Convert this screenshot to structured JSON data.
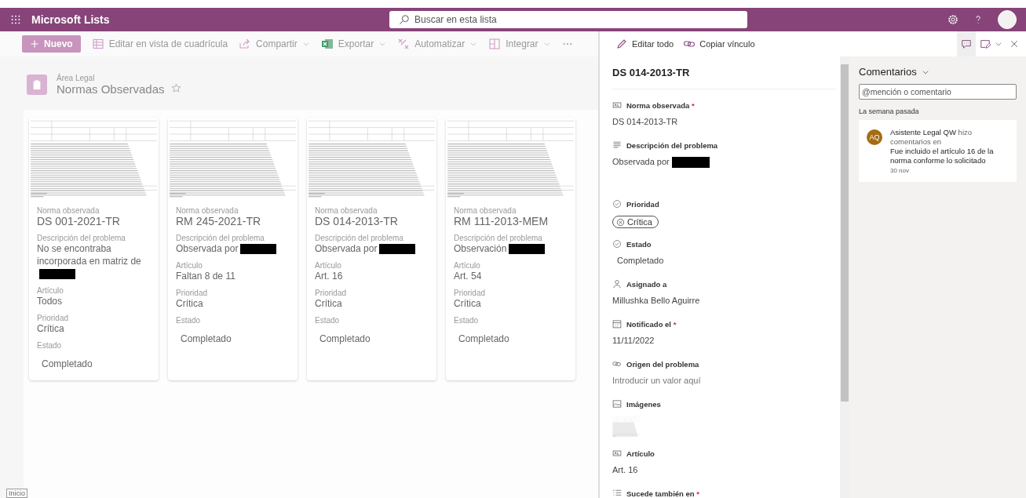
{
  "app": {
    "name": "Microsoft Lists"
  },
  "search": {
    "placeholder": "Buscar en esta lista"
  },
  "toolbar": {
    "new_button": "Nuevo",
    "actions": [
      {
        "kind": "grid",
        "label": "Editar en vista de cuadrícula",
        "dropdown": false
      },
      {
        "kind": "share",
        "label": "Compartir",
        "dropdown": true
      },
      {
        "kind": "excel",
        "label": "Exportar",
        "dropdown": true
      },
      {
        "kind": "flow",
        "label": "Automatizar",
        "dropdown": true
      },
      {
        "kind": "integrate",
        "label": "Integrar",
        "dropdown": true
      }
    ]
  },
  "list": {
    "site": "Área Legal",
    "title": "Normas Observadas",
    "favorite": false
  },
  "cards": [
    {
      "fields": [
        {
          "label": "Norma observada",
          "value": "DS 001-2021-TR",
          "redacted": false
        },
        {
          "label": "Descripción del problema",
          "value": "No se encontraba incorporada en matriz de",
          "redacted": true
        },
        {
          "label": "Artículo",
          "value": "Todos",
          "redacted": false
        },
        {
          "label": "Prioridad",
          "value": "Crítica",
          "redacted": false
        },
        {
          "label": "Estado",
          "value": "Completado",
          "redacted": false
        }
      ]
    },
    {
      "fields": [
        {
          "label": "Norma observada",
          "value": "RM 245-2021-TR",
          "redacted": false
        },
        {
          "label": "Descripción del problema",
          "value": "Observada por",
          "redacted": true
        },
        {
          "label": "Artículo",
          "value": "Faltan 8 de 11",
          "redacted": false
        },
        {
          "label": "Prioridad",
          "value": "Crítica",
          "redacted": false
        },
        {
          "label": "Estado",
          "value": "Completado",
          "redacted": false
        }
      ]
    },
    {
      "fields": [
        {
          "label": "Norma observada",
          "value": "DS 014-2013-TR",
          "redacted": false
        },
        {
          "label": "Descripción del problema",
          "value": "Observada por",
          "redacted": true
        },
        {
          "label": "Artículo",
          "value": "Art. 16",
          "redacted": false
        },
        {
          "label": "Prioridad",
          "value": "Crítica",
          "redacted": false
        },
        {
          "label": "Estado",
          "value": "Completado",
          "redacted": false
        }
      ]
    },
    {
      "fields": [
        {
          "label": "Norma observada",
          "value": "RM 111-2013-MEM",
          "redacted": false
        },
        {
          "label": "Descripción del problema",
          "value": "Observación",
          "redacted": true
        },
        {
          "label": "Artículo",
          "value": "Art. 54",
          "redacted": false
        },
        {
          "label": "Prioridad",
          "value": "Crítica",
          "redacted": false
        },
        {
          "label": "Estado",
          "value": "Completado",
          "redacted": false
        }
      ]
    }
  ],
  "panel": {
    "actions": [
      {
        "kind": "edit",
        "label": "Editar todo"
      },
      {
        "kind": "link",
        "label": "Copiar vínculo"
      }
    ],
    "view_buttons": [
      {
        "kind": "comments",
        "selected": true
      },
      {
        "kind": "form",
        "selected": false
      }
    ],
    "title": "DS 014-2013-TR",
    "fields": [
      {
        "label": "Norma observada",
        "required_mark": "*",
        "kind": "text",
        "value": "DS 014-2013-TR",
        "redacted": false
      },
      {
        "label": "Descripción del problema",
        "kind": "text",
        "value": "Observada por",
        "redacted": true
      },
      {
        "label": "Prioridad",
        "kind": "pill",
        "value": "Crítica",
        "redacted": false
      },
      {
        "label": "Estado",
        "kind": "choice",
        "value": "Completado",
        "redacted": false
      },
      {
        "label": "Asignado a",
        "kind": "text",
        "value": "Millushka Bello Aguirre",
        "redacted": false
      },
      {
        "label": "Notificado el",
        "required_mark": "*",
        "kind": "text",
        "value": "11/11/2022",
        "redacted": false
      },
      {
        "label": "Origen del problema",
        "kind": "empty",
        "placeholder": "Introducir un valor aquí"
      },
      {
        "label": "Imágenes",
        "kind": "image"
      },
      {
        "label": "Artículo",
        "kind": "text",
        "value": "Art. 16",
        "redacted": false
      },
      {
        "label": "Sucede también en",
        "required_mark": "*",
        "kind": "none"
      }
    ]
  },
  "comments": {
    "title": "Comentarios",
    "placeholder": "@mención o comentario",
    "group": "La semana pasada",
    "items": [
      {
        "avatar": "AQ",
        "author": "Asistente Legal QW",
        "action": "hizo comentarios en",
        "text": "Fue incluido el artículo 16 de la norma conforme lo solicitado",
        "date": "30 nov"
      }
    ]
  },
  "tooltip": "Inicio"
}
